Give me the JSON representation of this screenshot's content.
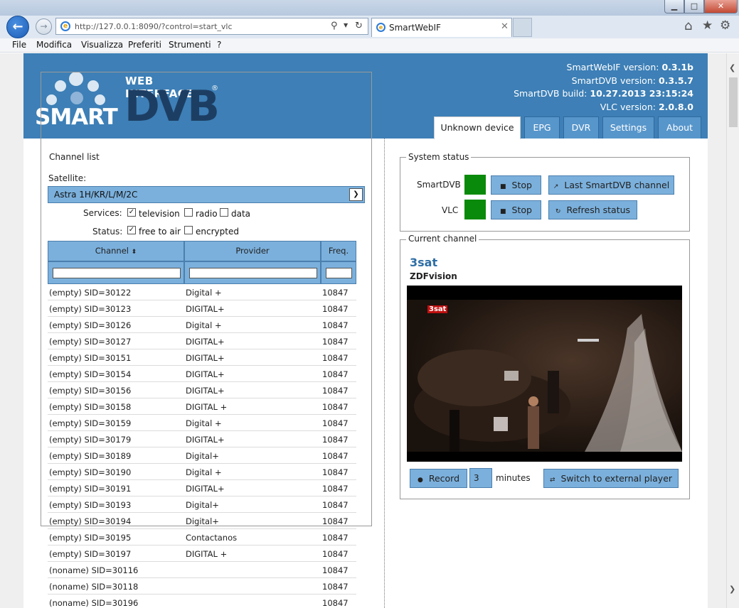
{
  "browser": {
    "window_buttons": {
      "minimize": "▁",
      "maximize": "□",
      "close": "✕"
    },
    "address": "http://127.0.0.1:8090/?control=start_vlc",
    "tab_title": "SmartWebIF",
    "menu": [
      "File",
      "Modifica",
      "Visualizza",
      "Preferiti",
      "Strumenti",
      "?"
    ]
  },
  "header": {
    "logo": {
      "web_interface": "WEB INTERFACE",
      "smart": "SMART",
      "dvb": "DVB",
      "reg": "®"
    },
    "versions": [
      {
        "label": "SmartWebIF version:",
        "value": "0.3.1b"
      },
      {
        "label": "SmartDVB version:",
        "value": "0.3.5.7"
      },
      {
        "label": "SmartDVB build:",
        "value": "10.27.2013 23:15:24"
      },
      {
        "label": "VLC version:",
        "value": "2.0.8.0"
      }
    ],
    "tabs": [
      "Unknown device",
      "EPG",
      "DVR",
      "Settings",
      "About"
    ],
    "active_tab": "Unknown device"
  },
  "channel_list": {
    "legend": "Channel list",
    "satellite_label": "Satellite:",
    "satellite_value": "Astra 1H/KR/L/M/2C",
    "services_label": "Services:",
    "services": [
      {
        "label": "television",
        "checked": true
      },
      {
        "label": "radio",
        "checked": false
      },
      {
        "label": "data",
        "checked": false
      }
    ],
    "status_label": "Status:",
    "status": [
      {
        "label": "free to air",
        "checked": true
      },
      {
        "label": "encrypted",
        "checked": false
      }
    ],
    "columns": [
      "Channel",
      "Provider",
      "Freq."
    ],
    "sort_indicator": "⬍",
    "rows": [
      [
        "(empty) SID=30122",
        "Digital +",
        "10847"
      ],
      [
        "(empty) SID=30123",
        "DIGITAL+",
        "10847"
      ],
      [
        "(empty) SID=30126",
        "Digital +",
        "10847"
      ],
      [
        "(empty) SID=30127",
        "DIGITAL+",
        "10847"
      ],
      [
        "(empty) SID=30151",
        "DIGITAL+",
        "10847"
      ],
      [
        "(empty) SID=30154",
        "DIGITAL+",
        "10847"
      ],
      [
        "(empty) SID=30156",
        "DIGITAL+",
        "10847"
      ],
      [
        "(empty) SID=30158",
        "DIGITAL +",
        "10847"
      ],
      [
        "(empty) SID=30159",
        "Digital +",
        "10847"
      ],
      [
        "(empty) SID=30179",
        "DIGITAL+",
        "10847"
      ],
      [
        "(empty) SID=30189",
        "Digital+",
        "10847"
      ],
      [
        "(empty) SID=30190",
        "Digital +",
        "10847"
      ],
      [
        "(empty) SID=30191",
        "DIGITAL+",
        "10847"
      ],
      [
        "(empty) SID=30193",
        "Digital+",
        "10847"
      ],
      [
        "(empty) SID=30194",
        "Digital+",
        "10847"
      ],
      [
        "(empty) SID=30195",
        "Contactanos",
        "10847"
      ],
      [
        "(empty) SID=30197",
        "DIGITAL +",
        "10847"
      ],
      [
        "(noname) SID=30116",
        "",
        "10847"
      ],
      [
        "(noname) SID=30118",
        "",
        "10847"
      ],
      [
        "(noname) SID=30196",
        "",
        "10847"
      ]
    ]
  },
  "system_status": {
    "legend": "System status",
    "smartdvb_label": "SmartDVB",
    "vlc_label": "VLC",
    "stop_label": "Stop",
    "last_channel_label": "Last SmartDVB channel",
    "refresh_label": "Refresh status",
    "led_color": "#0a8a0a"
  },
  "current_channel": {
    "legend": "Current channel",
    "name": "3sat",
    "provider": "ZDFvision",
    "video_logo": "3sat",
    "record_label": "Record",
    "minutes_value": "3",
    "minutes_label": "minutes",
    "external_label": "Switch to external player"
  }
}
